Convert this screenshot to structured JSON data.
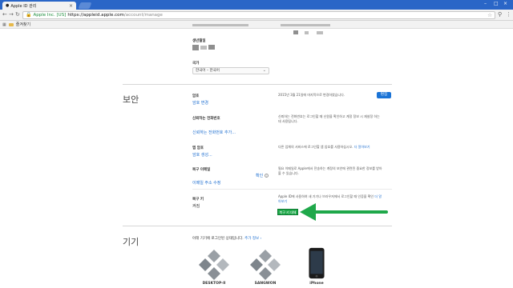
{
  "browser": {
    "tab_title": "Apple ID 관리",
    "tab_close": "×",
    "window_controls": [
      "–",
      "□",
      "×"
    ],
    "secure_label": "Apple Inc. [US]",
    "url_host": "https://appleid.apple.com",
    "url_path": "/account/manage",
    "bookmark_label": "즐겨찾기"
  },
  "account": {
    "birthday_label": "생년월일",
    "country_label": "국가",
    "country_value": "한국어 – 한국어"
  },
  "security": {
    "title": "보안",
    "edit_button": "편집",
    "password": {
      "label": "암호",
      "link": "암호 변경",
      "desc": "2015년 3월 21일에 마지막으로 변경하였습니다."
    },
    "trusted_phone": {
      "label": "신뢰하는 전화번호",
      "link": "신뢰하는 전화번호 추가...",
      "desc": "신뢰하는 전화번호는 로그인할 때 신원을 확인하고 계정 정보 시 재설정 하는 데 사용됩니다."
    },
    "app_passwords": {
      "label": "앱 암호",
      "link": "암호 생성...",
      "desc": "다른 업체의 서비스에 로그인할 앱 암호를 사용하십시오.",
      "desc_link": "더 알아보기"
    },
    "recovery_email": {
      "label": "복구 이메일",
      "status": "확인",
      "link": "이메일 주소 수정",
      "desc": "필요 이메일로 Apple에서 전송하는 계정의 보안에 관련된 중요한 정보를 받아볼 수 있습니다."
    },
    "recovery_key": {
      "label": "복구 키",
      "value": "켜짐",
      "desc": "Apple ID에 사용하여 새 기기나 브라우저에서 로그인할 때 인증을 확인",
      "desc_link": "더 알아보기",
      "button": "복구 키 대체"
    }
  },
  "devices": {
    "title": "기기",
    "intro": "아래 기기에 로그인된 상태입니다.",
    "intro_link": "추가 정보 ›",
    "items": [
      {
        "name": "DESKTOP-II",
        "icon": "windows-icon"
      },
      {
        "name": "SANGWON",
        "icon": "windows-icon"
      },
      {
        "name": "iPhone",
        "icon": "iphone-icon"
      }
    ]
  },
  "colors": {
    "accent": "#1a73d6",
    "highlight": "#1fa84a",
    "tab_strip": "#2a66c7"
  }
}
